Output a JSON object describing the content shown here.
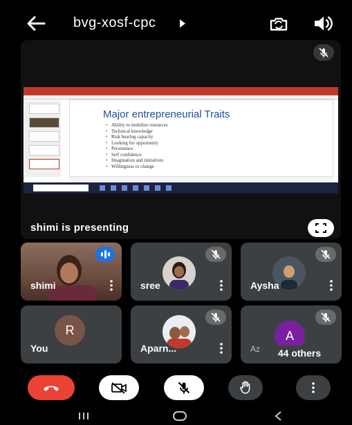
{
  "topbar": {
    "meeting_code": "bvg-xosf-cpc"
  },
  "presentation": {
    "presenting_text": "shimi is presenting",
    "slide": {
      "title": "Major entrepreneurial Traits",
      "bullets": [
        "Ability to mobilize resources",
        "Technical knowledge",
        "Risk bearing capacity",
        "Looking for opportunity",
        "Persistence",
        "Self confidence",
        "Imagination and initiatives",
        "Willingness to change"
      ]
    }
  },
  "participants": [
    {
      "name": "shimi",
      "status": "speaking"
    },
    {
      "name": "sree",
      "status": "muted"
    },
    {
      "name": "Aysha",
      "status": "muted"
    },
    {
      "name": "You",
      "avatar_letter": "R",
      "avatar_color": "#795548",
      "status": "muted"
    },
    {
      "name": "Aparn...",
      "status": "muted"
    },
    {
      "name": "Az",
      "avatar_letter": "A",
      "avatar_color": "#7b1fa2",
      "status": "muted"
    }
  ],
  "others_count_label": "44 others",
  "colors": {
    "end_call": "#ea4335",
    "speaking_badge": "#1a73e8",
    "tile_bg": "#3c4043"
  }
}
